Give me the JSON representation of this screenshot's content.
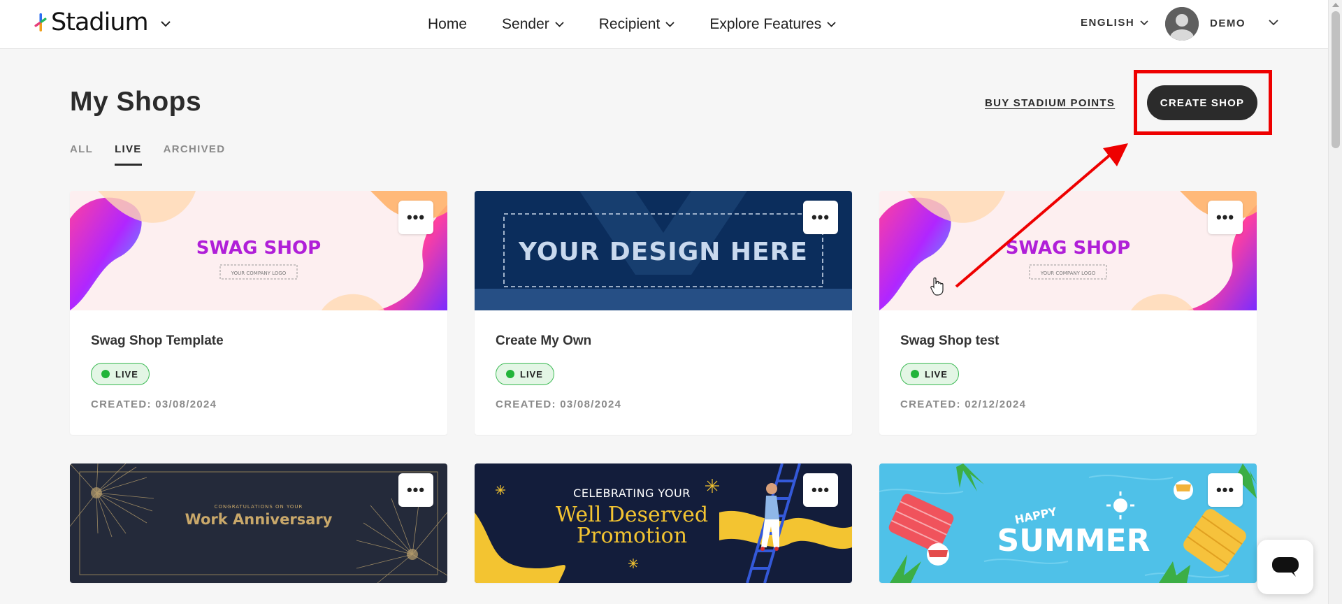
{
  "header": {
    "brand": "Stadium",
    "nav": [
      {
        "label": "Home",
        "has_menu": false
      },
      {
        "label": "Sender",
        "has_menu": true
      },
      {
        "label": "Recipient",
        "has_menu": true
      },
      {
        "label": "Explore Features",
        "has_menu": true
      }
    ],
    "language": "ENGLISH",
    "username": "DEMO"
  },
  "page": {
    "title": "My Shops",
    "buy_points_label": "BUY STADIUM POINTS",
    "create_shop_label": "CREATE SHOP",
    "tabs": [
      {
        "label": "ALL",
        "active": false
      },
      {
        "label": "LIVE",
        "active": true
      },
      {
        "label": "ARCHIVED",
        "active": false
      }
    ]
  },
  "shops": [
    {
      "title": "Swag Shop Template",
      "status": "LIVE",
      "created": "CREATED: 03/08/2024",
      "banner": "swag-shop",
      "banner_title": "SWAG SHOP",
      "banner_sub": "YOUR COMPANY LOGO"
    },
    {
      "title": "Create My Own",
      "status": "LIVE",
      "created": "CREATED: 03/08/2024",
      "banner": "your-design",
      "banner_title": "YOUR DESIGN HERE"
    },
    {
      "title": "Swag Shop test",
      "status": "LIVE",
      "created": "CREATED: 02/12/2024",
      "banner": "swag-shop",
      "banner_title": "SWAG SHOP",
      "banner_sub": "YOUR COMPANY LOGO"
    },
    {
      "banner": "work-anniversary",
      "banner_sub": "CONGRATULATIONS ON YOUR",
      "banner_title": "Work Anniversary"
    },
    {
      "banner": "promotion",
      "banner_sub": "CELEBRATING YOUR",
      "banner_title": "Well Deserved",
      "banner_title2": "Promotion"
    },
    {
      "banner": "summer",
      "banner_sub": "HAPPY",
      "banner_title": "SUMMER"
    }
  ],
  "more_label": "•••",
  "colors": {
    "accent_dark": "#2b2b2b",
    "live_green": "#22b43a",
    "highlight_red": "#ee0000",
    "swag_magenta": "#b01fd8",
    "design_navy": "#0b2d5c",
    "anniversary_bg": "#242a3a",
    "anniversary_gold": "#c9a86a",
    "summer_blue": "#4fc1e8"
  }
}
